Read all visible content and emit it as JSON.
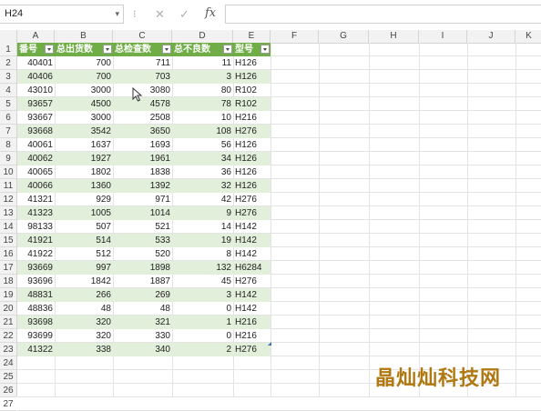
{
  "name_box": {
    "value": "H24"
  },
  "formula_bar": {
    "fx_label": "fx",
    "value": ""
  },
  "columns": [
    "A",
    "B",
    "C",
    "D",
    "E",
    "F",
    "G",
    "H",
    "I",
    "J",
    "K"
  ],
  "rows": [
    "1",
    "2",
    "3",
    "4",
    "5",
    "6",
    "7",
    "8",
    "9",
    "10",
    "11",
    "12",
    "13",
    "14",
    "15",
    "16",
    "17",
    "18",
    "19",
    "20",
    "21",
    "22",
    "23",
    "24",
    "25",
    "26",
    "27"
  ],
  "table": {
    "headers": [
      "番号",
      "总出货数",
      "总检查数",
      "总不良数",
      "型号"
    ],
    "data": [
      [
        "40401",
        "700",
        "711",
        "11",
        "H126"
      ],
      [
        "40406",
        "700",
        "703",
        "3",
        "H126"
      ],
      [
        "43010",
        "3000",
        "3080",
        "80",
        "R102"
      ],
      [
        "93657",
        "4500",
        "4578",
        "78",
        "R102"
      ],
      [
        "93667",
        "3000",
        "2508",
        "10",
        "H216"
      ],
      [
        "93668",
        "3542",
        "3650",
        "108",
        "H276"
      ],
      [
        "40061",
        "1637",
        "1693",
        "56",
        "H126"
      ],
      [
        "40062",
        "1927",
        "1961",
        "34",
        "H126"
      ],
      [
        "40065",
        "1802",
        "1838",
        "36",
        "H126"
      ],
      [
        "40066",
        "1360",
        "1392",
        "32",
        "H126"
      ],
      [
        "41321",
        "929",
        "971",
        "42",
        "H276"
      ],
      [
        "41323",
        "1005",
        "1014",
        "9",
        "H276"
      ],
      [
        "98133",
        "507",
        "521",
        "14",
        "H142"
      ],
      [
        "41921",
        "514",
        "533",
        "19",
        "H142"
      ],
      [
        "41922",
        "512",
        "520",
        "8",
        "H142"
      ],
      [
        "93669",
        "997",
        "1898",
        "132",
        "H6284"
      ],
      [
        "93696",
        "1842",
        "1887",
        "45",
        "H276"
      ],
      [
        "48831",
        "266",
        "269",
        "3",
        "H142"
      ],
      [
        "48836",
        "48",
        "48",
        "0",
        "H142"
      ],
      [
        "93698",
        "320",
        "321",
        "1",
        "H216"
      ],
      [
        "93699",
        "320",
        "330",
        "0",
        "H216"
      ],
      [
        "41322",
        "338",
        "340",
        "2",
        "H276"
      ]
    ]
  },
  "watermark": {
    "text": "晶灿灿科技网"
  },
  "colors": {
    "header_green": "#70ad47",
    "band_green": "#e2efda"
  }
}
